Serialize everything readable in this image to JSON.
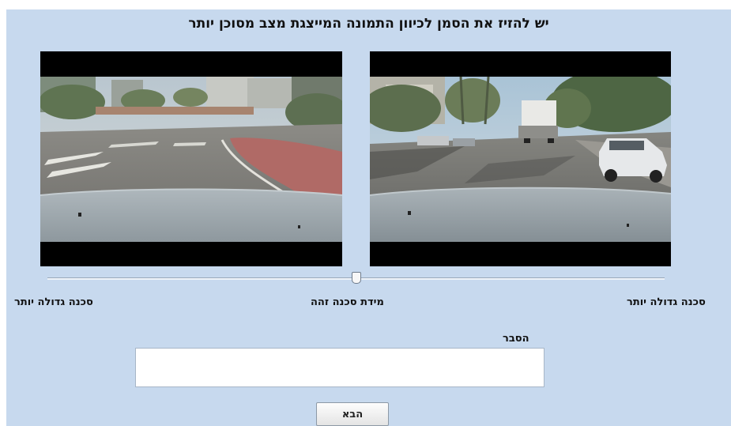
{
  "instruction_title": "יש להזיז את הסמן לכיוון התמונה המייצגת מצב מסוכן יותר",
  "videos": {
    "left": {
      "icon": "video-frame-roundabout"
    },
    "right": {
      "icon": "video-frame-street-truck"
    }
  },
  "slider": {
    "value_fraction": 0.5,
    "labels": {
      "left": "סכנה גדולה יותר",
      "center": "מידת סכנה זהה",
      "right": "סכנה גדולה יותר"
    }
  },
  "explanation": {
    "label": "הסבר",
    "value": "",
    "placeholder": ""
  },
  "next_button": {
    "label": "הבא"
  },
  "colors": {
    "page_background": "#c7d9ee",
    "video_letterbox": "#000000"
  }
}
